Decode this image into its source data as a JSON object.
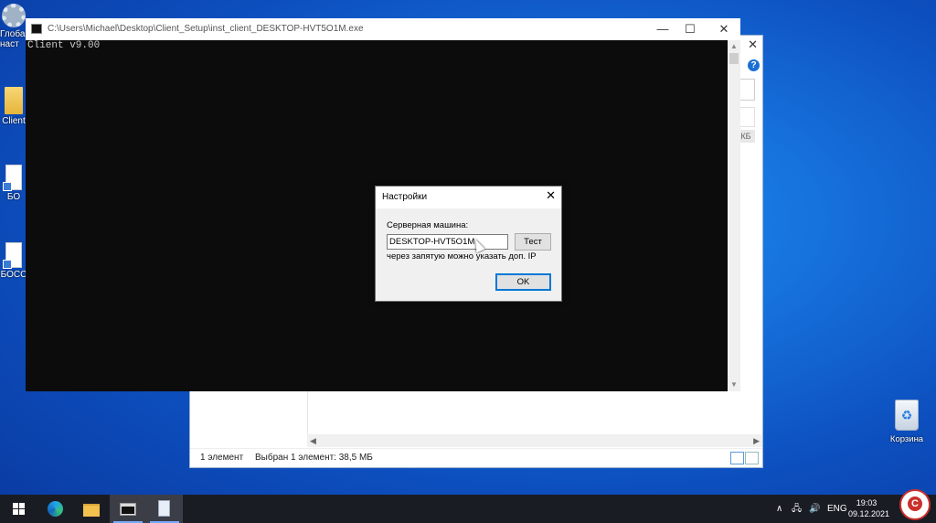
{
  "desktop": {
    "icons": [
      {
        "label": "Глоба\nнаст"
      },
      {
        "label": "Client"
      },
      {
        "label": "БО"
      },
      {
        "label": "БОСС"
      }
    ],
    "recycle_bin": "Корзина"
  },
  "explorer": {
    "status_items": "1 элемент",
    "status_selected": "Выбран 1 элемент: 38,5 МБ",
    "size_unit": "КБ",
    "help_glyph": "?"
  },
  "console": {
    "title": "C:\\Users\\Michael\\Desktop\\Client_Setup\\inst_client_DESKTOP-HVT5O1M.exe",
    "output": "Client v9.00",
    "minimize": "—",
    "maximize": "☐",
    "close": "✕"
  },
  "dialog": {
    "title": "Настройки",
    "server_label": "Серверная машина:",
    "server_value": "DESKTOP-HVT5O1M",
    "test_button": "Тест",
    "hint": "через запятую можно указать доп. IP",
    "ok_button": "OK",
    "close": "✕"
  },
  "taskbar": {
    "language": "ENG",
    "time": "19:03",
    "date": "09.12.2021",
    "tray_up": "∧",
    "badge_letter": "C"
  }
}
